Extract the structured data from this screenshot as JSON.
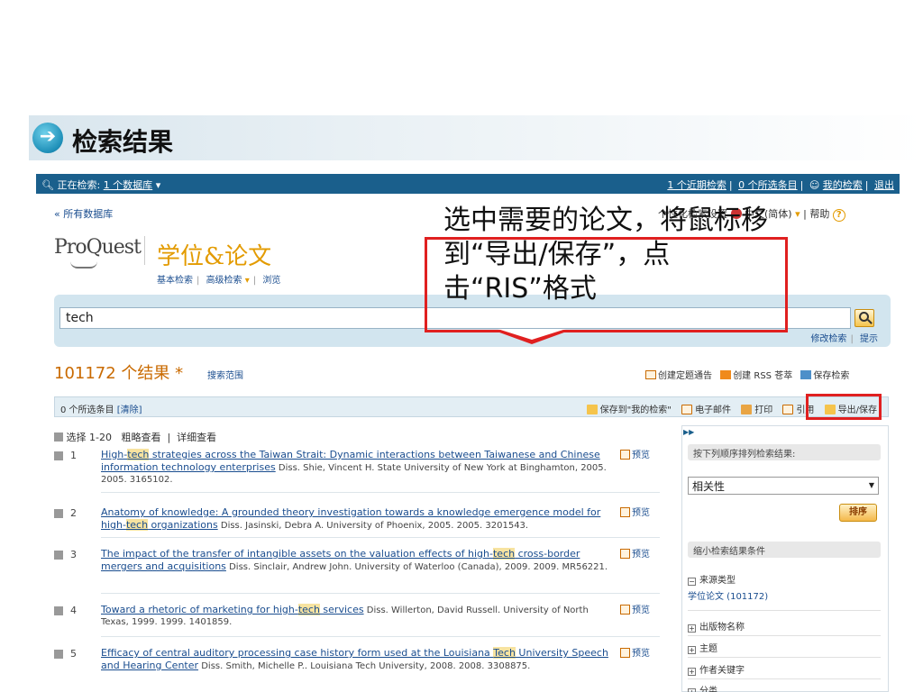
{
  "slide": {
    "title": "检索结果"
  },
  "topbar": {
    "searching_label": "正在检索:",
    "db_link": "1 个数据库",
    "recent": "1 个近期检索",
    "selected": "0 个所选条目",
    "my_searches": "我的检索",
    "logout": "退出"
  },
  "toplinks": {
    "all_databases": "« 所有数据库",
    "personal": "个性化检索设置",
    "language": "中文(简体)",
    "help": "帮助"
  },
  "brand": {
    "logo": "ProQuest",
    "product": "学位&论文"
  },
  "subnav": {
    "basic": "基本检索",
    "advanced": "高级检索",
    "browse": "浏览"
  },
  "search": {
    "value": "tech",
    "modify": "修改检索",
    "tips": "提示"
  },
  "results_header": {
    "count": "101172 个结果 *",
    "scope": "搜索范围",
    "alert": "创建定题通告",
    "rss": "创建 RSS 苍萃",
    "save_search": "保存检索"
  },
  "toolbar": {
    "selected": "0 个所选条目",
    "clear": "[清除]",
    "save_my": "保存到\"我的检索\"",
    "email": "电子邮件",
    "print": "打印",
    "cite": "引用",
    "export": "导出/保存"
  },
  "viewbar": {
    "select": "选择 1-20",
    "brief": "粗略查看",
    "detailed": "详细查看"
  },
  "preview_label": "预览",
  "results": [
    {
      "num": "1",
      "title_pre": "High-",
      "title_hl": "tech",
      "title_post": " strategies across the Taiwan Strait: Dynamic interactions between Taiwanese and Chinese information technology enterprises",
      "meta": " Diss. Shie, Vincent H.  State University of New York at Binghamton, 2005. 2005. 3165102."
    },
    {
      "num": "2",
      "title_pre": "Anatomy of knowledge: A grounded theory investigation towards a knowledge emergence model for high-",
      "title_hl": "tech",
      "title_post": " organizations",
      "meta": " Diss. Jasinski, Debra A.  University of Phoenix, 2005. 2005. 3201543."
    },
    {
      "num": "3",
      "title_pre": "The impact of the transfer of intangible assets on the valuation effects of high-",
      "title_hl": "tech",
      "title_post": " cross-border mergers and acquisitions",
      "meta": " Diss. Sinclair, Andrew John.  University of Waterloo (Canada), 2009. 2009. MR56221."
    },
    {
      "num": "4",
      "title_pre": "Toward a rhetoric of marketing for high-",
      "title_hl": "tech",
      "title_post": " services",
      "meta": " Diss. Willerton, David Russell.  University of North Texas, 1999. 1999. 1401859."
    },
    {
      "num": "5",
      "title_pre": "Efficacy of central auditory processing case history form used at the Louisiana ",
      "title_hl": "Tech",
      "title_post": " University Speech and Hearing Center",
      "meta": " Diss. Smith, Michelle P..  Louisiana Tech University, 2008. 2008. 3308875."
    }
  ],
  "sidebar": {
    "sort_head": "按下列顺序排列检索结果:",
    "sort_value": "相关性",
    "sort_button": "排序",
    "narrow_head": "缩小检索结果条件",
    "source_type": "来源类型",
    "source_value": "学位论文 (101172)",
    "publication": "出版物名称",
    "subject": "主题",
    "keyword": "作者关键字",
    "category": "分类"
  },
  "annotation": {
    "text": "选中需要的论文，将鼠标移到“导出/保存”，点击“RIS”格式"
  },
  "colors": {
    "accent": "#1a5f8c",
    "highlight": "#e02020",
    "brand_orange": "#e39b00"
  }
}
